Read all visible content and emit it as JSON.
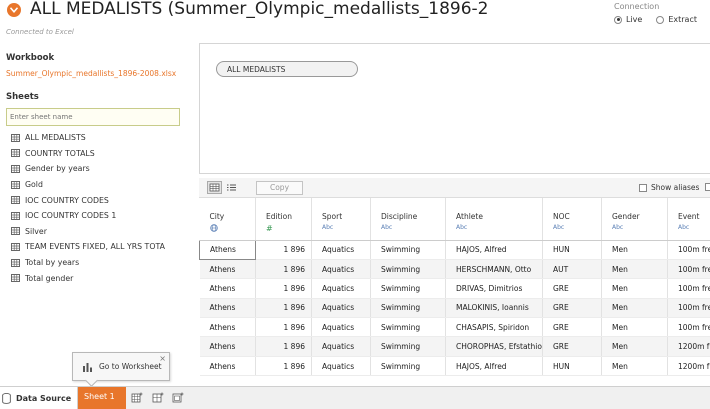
{
  "header": {
    "title": "ALL MEDALISTS (Summer_Olympic_medallists_1896-2",
    "subtitle": "Connected to Excel",
    "toggle_icon": "chevron-down-icon",
    "accent_color": "#e8762b"
  },
  "connection": {
    "label": "Connection",
    "options": [
      {
        "label": "Live",
        "selected": true
      },
      {
        "label": "Extract",
        "selected": false
      }
    ]
  },
  "workbook": {
    "heading": "Workbook",
    "file": "Summer_Olympic_medallists_1896-2008.xlsx"
  },
  "sheets": {
    "heading": "Sheets",
    "search_placeholder": "Enter sheet name",
    "items": [
      {
        "label": "ALL MEDALISTS"
      },
      {
        "label": "COUNTRY TOTALS"
      },
      {
        "label": "Gender by years"
      },
      {
        "label": "Gold"
      },
      {
        "label": "IOC COUNTRY CODES"
      },
      {
        "label": "IOC COUNTRY CODES 1"
      },
      {
        "label": "Silver"
      },
      {
        "label": "TEAM EVENTS FIXED, ALL YRS TOTA"
      },
      {
        "label": "Total by years"
      },
      {
        "label": "Total gender"
      }
    ]
  },
  "canvas": {
    "table_pill": "ALL MEDALISTS"
  },
  "grid_toolbar": {
    "copy_label": "Copy",
    "show_aliases_label": "Show aliases"
  },
  "grid": {
    "columns": [
      {
        "name": "City",
        "type": "globe-icon"
      },
      {
        "name": "Edition",
        "type": "#"
      },
      {
        "name": "Sport",
        "type": "Abc"
      },
      {
        "name": "Discipline",
        "type": "Abc"
      },
      {
        "name": "Athlete",
        "type": "Abc"
      },
      {
        "name": "NOC",
        "type": "Abc"
      },
      {
        "name": "Gender",
        "type": "Abc"
      },
      {
        "name": "Event",
        "type": "Abc"
      }
    ],
    "rows": [
      [
        "Athens",
        "1 896",
        "Aquatics",
        "Swimming",
        "HAJOS, Alfred",
        "HUN",
        "Men",
        "100m free"
      ],
      [
        "Athens",
        "1 896",
        "Aquatics",
        "Swimming",
        "HERSCHMANN, Otto",
        "AUT",
        "Men",
        "100m free"
      ],
      [
        "Athens",
        "1 896",
        "Aquatics",
        "Swimming",
        "DRIVAS, Dimitrios",
        "GRE",
        "Men",
        "100m free"
      ],
      [
        "Athens",
        "1 896",
        "Aquatics",
        "Swimming",
        "MALOKINIS, Ioannis",
        "GRE",
        "Men",
        "100m free"
      ],
      [
        "Athens",
        "1 896",
        "Aquatics",
        "Swimming",
        "CHASAPIS, Spiridon",
        "GRE",
        "Men",
        "100m free"
      ],
      [
        "Athens",
        "1 896",
        "Aquatics",
        "Swimming",
        "CHOROPHAS, Efstathios",
        "GRE",
        "Men",
        "1200m free"
      ],
      [
        "Athens",
        "1 896",
        "Aquatics",
        "Swimming",
        "HAJOS, Alfred",
        "HUN",
        "Men",
        "1200m free"
      ]
    ]
  },
  "tooltip": {
    "label": "Go to Worksheet",
    "close": "×"
  },
  "bottom_bar": {
    "data_source_label": "Data Source",
    "sheet_tab_label": "Sheet 1"
  }
}
